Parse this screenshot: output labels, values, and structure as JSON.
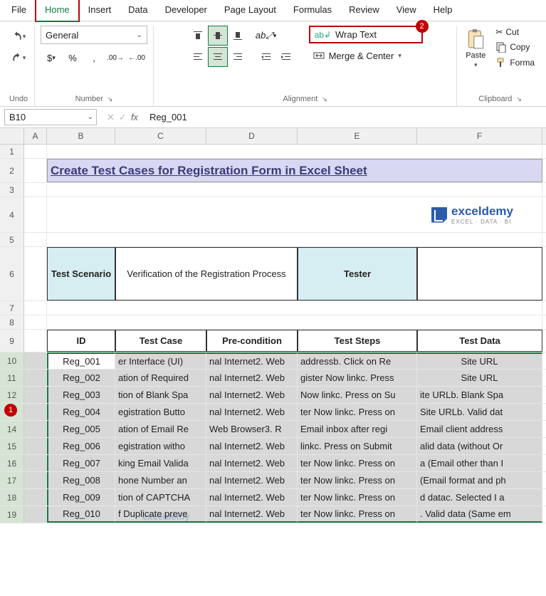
{
  "menu": [
    "File",
    "Home",
    "Insert",
    "Data",
    "Developer",
    "Page Layout",
    "Formulas",
    "Review",
    "View",
    "Help"
  ],
  "active_menu": "Home",
  "ribbon": {
    "undo_label": "Undo",
    "number_format": "General",
    "number_label": "Number",
    "alignment_label": "Alignment",
    "clipboard_label": "Clipboard",
    "wrap_text": "Wrap Text",
    "merge_center": "Merge & Center",
    "paste": "Paste",
    "cut": "Cut",
    "copy": "Copy",
    "format": "Forma"
  },
  "callouts": {
    "one": "1",
    "two": "2"
  },
  "namebox": "B10",
  "formula_value": "Reg_001",
  "columns": [
    "A",
    "B",
    "C",
    "D",
    "E",
    "F"
  ],
  "title": "Create Test Cases for Registration Form in Excel Sheet",
  "logo": {
    "name": "exceldemy",
    "sub": "EXCEL · DATA · BI"
  },
  "meta": {
    "scenario_label": "Test Scenario",
    "scenario_value": "Verification of the Registration Process",
    "tester_label": "Tester"
  },
  "table": {
    "headers": [
      "ID",
      "Test Case",
      "Pre-condition",
      "Test Steps",
      "Test Data"
    ],
    "rows": [
      {
        "id": "Reg_001",
        "tc": "er Interface (UI)",
        "pre": "nal Internet2. Web",
        "steps": "addressb. Click on Re",
        "data": "Site URL"
      },
      {
        "id": "Reg_002",
        "tc": "ation of Required",
        "pre": "nal Internet2. Web",
        "steps": "gister Now linkc. Press",
        "data": "Site URL"
      },
      {
        "id": "Reg_003",
        "tc": "tion of Blank Spa",
        "pre": "nal Internet2. Web",
        "steps": "Now linkc. Press on Su",
        "data": "ite URLb. Blank Spa"
      },
      {
        "id": "Reg_004",
        "tc": "egistration Butto",
        "pre": "nal Internet2. Web",
        "steps": "ter Now linkc. Press on",
        "data": "Site URLb. Valid dat"
      },
      {
        "id": "Reg_005",
        "tc": "ation of Email Re",
        "pre": "Web Browser3. R",
        "steps": "Email inbox after regi",
        "data": "Email client address"
      },
      {
        "id": "Reg_006",
        "tc": "egistration witho",
        "pre": "nal Internet2. Web",
        "steps": "linkc. Press on Submit",
        "data": "alid data (without Or"
      },
      {
        "id": "Reg_007",
        "tc": "king Email Valida",
        "pre": "nal Internet2. Web",
        "steps": "ter Now linkc. Press on",
        "data": "a (Email other than I"
      },
      {
        "id": "Reg_008",
        "tc": "hone Number an",
        "pre": "nal Internet2. Web",
        "steps": "ter Now linkc. Press on",
        "data": "(Email format and ph"
      },
      {
        "id": "Reg_009",
        "tc": "tion of CAPTCHA",
        "pre": "nal Internet2. Web",
        "steps": "ter Now linkc. Press on",
        "data": "d datac. Selected I a"
      },
      {
        "id": "Reg_010",
        "tc": "f Duplicate preve",
        "pre": "nal Internet2. Web",
        "steps": "ter Now linkc. Press on",
        "data": ". Valid data (Same em"
      }
    ]
  },
  "watermark": "exceldemy"
}
